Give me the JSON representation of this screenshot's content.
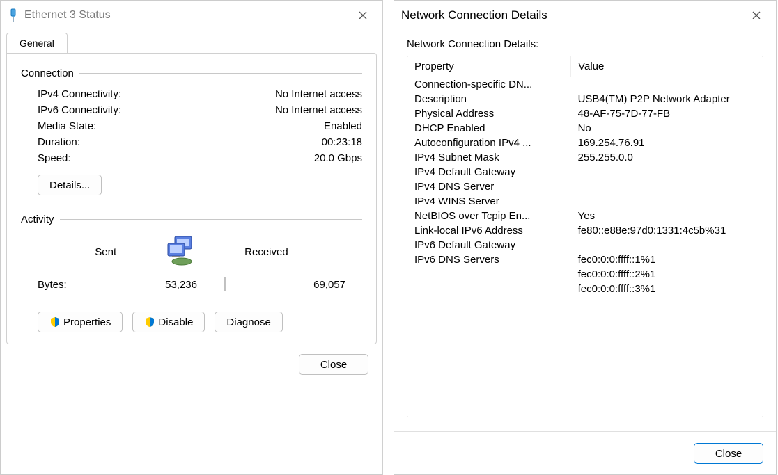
{
  "status": {
    "title": "Ethernet 3 Status",
    "tab_general": "General",
    "section_connection": "Connection",
    "section_activity": "Activity",
    "rows": {
      "ipv4_label": "IPv4 Connectivity:",
      "ipv4_value": "No Internet access",
      "ipv6_label": "IPv6 Connectivity:",
      "ipv6_value": "No Internet access",
      "media_label": "Media State:",
      "media_value": "Enabled",
      "duration_label": "Duration:",
      "duration_value": "00:23:18",
      "speed_label": "Speed:",
      "speed_value": "20.0 Gbps"
    },
    "details_button": "Details...",
    "activity": {
      "sent_label": "Sent",
      "received_label": "Received",
      "bytes_label": "Bytes:",
      "sent_value": "53,236",
      "received_value": "69,057"
    },
    "buttons": {
      "properties": "Properties",
      "disable": "Disable",
      "diagnose": "Diagnose",
      "close": "Close"
    }
  },
  "details": {
    "title": "Network Connection Details",
    "caption": "Network Connection Details:",
    "header_property": "Property",
    "header_value": "Value",
    "rows": [
      {
        "p": "Connection-specific DN...",
        "v": ""
      },
      {
        "p": "Description",
        "v": "USB4(TM) P2P Network Adapter"
      },
      {
        "p": "Physical Address",
        "v": "48-AF-75-7D-77-FB"
      },
      {
        "p": "DHCP Enabled",
        "v": "No"
      },
      {
        "p": "Autoconfiguration IPv4 ...",
        "v": "169.254.76.91"
      },
      {
        "p": "IPv4 Subnet Mask",
        "v": "255.255.0.0"
      },
      {
        "p": "IPv4 Default Gateway",
        "v": ""
      },
      {
        "p": "IPv4 DNS Server",
        "v": ""
      },
      {
        "p": "IPv4 WINS Server",
        "v": ""
      },
      {
        "p": "NetBIOS over Tcpip En...",
        "v": "Yes"
      },
      {
        "p": "Link-local IPv6 Address",
        "v": "fe80::e88e:97d0:1331:4c5b%31"
      },
      {
        "p": "IPv6 Default Gateway",
        "v": ""
      },
      {
        "p": "IPv6 DNS Servers",
        "v": "fec0:0:0:ffff::1%1"
      },
      {
        "p": "",
        "v": "fec0:0:0:ffff::2%1"
      },
      {
        "p": "",
        "v": "fec0:0:0:ffff::3%1"
      }
    ],
    "close": "Close"
  }
}
